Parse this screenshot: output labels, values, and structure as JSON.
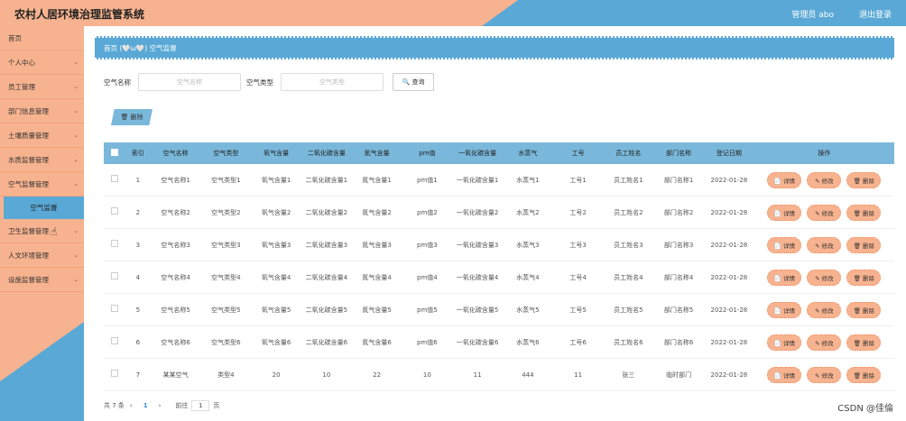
{
  "header": {
    "title": "农村人居环境治理监管系统",
    "admin": "管理员 abo",
    "logout": "退出登录"
  },
  "sidebar": {
    "items": [
      {
        "label": "首页",
        "has_chev": false
      },
      {
        "label": "个人中心",
        "has_chev": true
      },
      {
        "label": "员工管理",
        "has_chev": true
      },
      {
        "label": "部门信息管理",
        "has_chev": true
      },
      {
        "label": "土壤质量管理",
        "has_chev": true
      },
      {
        "label": "水质监督管理",
        "has_chev": true
      },
      {
        "label": "空气监督管理",
        "has_chev": true
      }
    ],
    "sub_active": "空气监督",
    "items_after": [
      {
        "label": "卫生监督管理",
        "has_chev": true
      },
      {
        "label": "人文环境管理",
        "has_chev": true
      },
      {
        "label": "设施监督管理",
        "has_chev": true
      }
    ]
  },
  "breadcrumb": "首页 (🤍ω🤍) 空气监督",
  "search": {
    "name_label": "空气名称",
    "name_placeholder": "空气名称",
    "type_label": "空气类型",
    "type_placeholder": "空气类型",
    "query_label": "🔍 查询"
  },
  "delete_button": "🗑 删除",
  "table": {
    "headers": [
      "",
      "索引",
      "空气名称",
      "空气类型",
      "氧气含量",
      "二氧化碳含量",
      "氮气含量",
      "pm值",
      "一氧化碳含量",
      "水蒸气",
      "工号",
      "员工姓名",
      "部门名称",
      "登记日期",
      "操作"
    ],
    "rows": [
      [
        "1",
        "空气名称1",
        "空气类型1",
        "氧气含量1",
        "二氧化碳含量1",
        "氮气含量1",
        "pm值1",
        "一氧化碳含量1",
        "水蒸气1",
        "工号1",
        "员工姓名1",
        "部门名称1",
        "2022-01-28"
      ],
      [
        "2",
        "空气名称2",
        "空气类型2",
        "氧气含量2",
        "二氧化碳含量2",
        "氮气含量2",
        "pm值2",
        "一氧化碳含量2",
        "水蒸气2",
        "工号2",
        "员工姓名2",
        "部门名称2",
        "2022-01-28"
      ],
      [
        "3",
        "空气名称3",
        "空气类型3",
        "氧气含量3",
        "二氧化碳含量3",
        "氮气含量3",
        "pm值3",
        "一氧化碳含量3",
        "水蒸气3",
        "工号3",
        "员工姓名3",
        "部门名称3",
        "2022-01-28"
      ],
      [
        "4",
        "空气名称4",
        "空气类型4",
        "氧气含量4",
        "二氧化碳含量4",
        "氮气含量4",
        "pm值4",
        "一氧化碳含量4",
        "水蒸气4",
        "工号4",
        "员工姓名4",
        "部门名称4",
        "2022-01-28"
      ],
      [
        "5",
        "空气名称5",
        "空气类型5",
        "氧气含量5",
        "二氧化碳含量5",
        "氮气含量5",
        "pm值5",
        "一氧化碳含量5",
        "水蒸气5",
        "工号5",
        "员工姓名5",
        "部门名称5",
        "2022-01-28"
      ],
      [
        "6",
        "空气名称6",
        "空气类型6",
        "氧气含量6",
        "二氧化碳含量6",
        "氮气含量6",
        "pm值6",
        "一氧化碳含量6",
        "水蒸气6",
        "工号6",
        "员工姓名6",
        "部门名称6",
        "2022-01-28"
      ],
      [
        "7",
        "某某空气",
        "类型4",
        "20",
        "10",
        "22",
        "10",
        "11",
        "444",
        "11",
        "张三",
        "临时部门",
        "2022-01-28"
      ]
    ],
    "ops": [
      "📄 详情",
      "✎ 修改",
      "🗑 删除"
    ]
  },
  "pager": {
    "total": "共 7 条",
    "prev": "‹",
    "page": "1",
    "next": "›",
    "goto": "前往",
    "goto_value": "1",
    "page_unit": "页"
  },
  "watermark": "CSDN @佳倫",
  "colors": {
    "peach": "#f7b38f",
    "blue": "#5aa8d6",
    "header_blue": "#7ab8db"
  }
}
